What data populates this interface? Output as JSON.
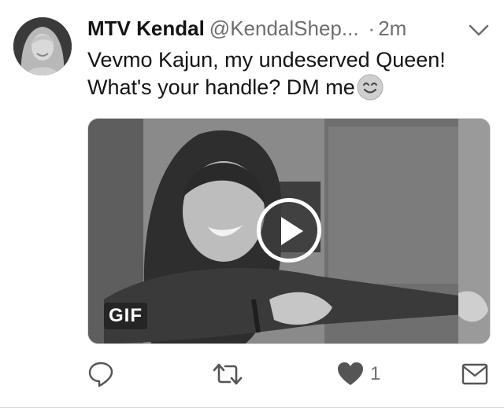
{
  "author": {
    "display_name": "MTV Kendal",
    "handle": "@KendalShep...",
    "separator": "·",
    "timestamp": "2m"
  },
  "tweet": {
    "text": "Vevmo Kajun, my undeserved Queen! What's your handle? DM me",
    "emoji": "smiling-face-icon"
  },
  "media": {
    "badge": "GIF",
    "play_icon": "play-icon"
  },
  "actions": {
    "reply_icon": "reply-icon",
    "retweet_icon": "retweet-icon",
    "like_icon": "heart-icon",
    "like_count": "1",
    "dm_icon": "envelope-icon"
  },
  "colors": {
    "text": "#141414",
    "secondary": "#6e6e6e",
    "icon": "#555555"
  }
}
